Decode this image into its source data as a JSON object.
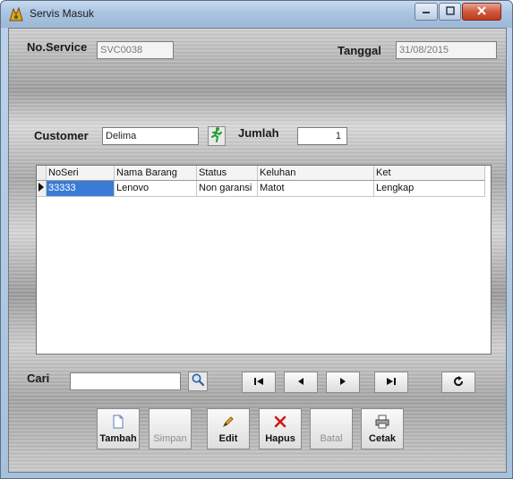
{
  "window": {
    "title": "Servis Masuk"
  },
  "form": {
    "no_service_label": "No.Service",
    "no_service_value": "SVC0038",
    "tanggal_label": "Tanggal",
    "tanggal_value": "31/08/2015",
    "customer_label": "Customer",
    "customer_value": "Delima",
    "jumlah_label": "Jumlah",
    "jumlah_value": "1"
  },
  "grid": {
    "columns": [
      "NoSeri",
      "Nama Barang",
      "Status",
      "Keluhan",
      "Ket"
    ],
    "rows": [
      {
        "noseri": "33333",
        "nama_barang": "Lenovo",
        "status": "Non garansi",
        "keluhan": "Matot",
        "ket": "Lengkap"
      }
    ]
  },
  "search": {
    "label": "Cari",
    "value": ""
  },
  "nav": {
    "first": "first",
    "prev": "previous",
    "next": "next",
    "last": "last",
    "refresh": "refresh"
  },
  "actions": {
    "tambah": "Tambah",
    "simpan": "Simpan",
    "edit": "Edit",
    "hapus": "Hapus",
    "batal": "Batal",
    "cetak": "Cetak"
  }
}
